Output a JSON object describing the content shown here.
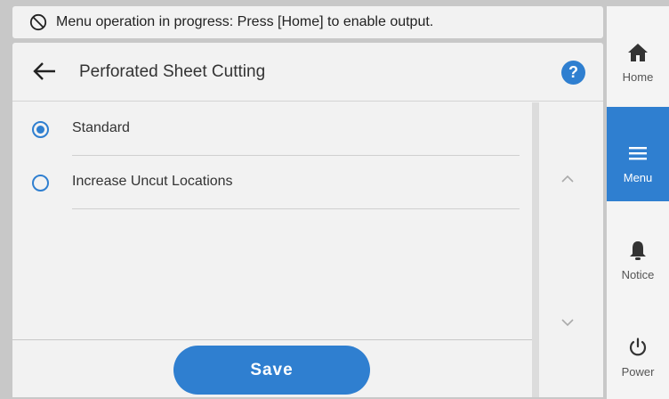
{
  "banner": {
    "text": "Menu operation in progress: Press [Home] to enable output.",
    "icon": "no-entry-icon"
  },
  "header": {
    "title": "Perforated Sheet Cutting",
    "back_icon": "back-arrow-icon",
    "help_label": "?"
  },
  "options": [
    {
      "label": "Standard",
      "selected": true
    },
    {
      "label": "Increase Uncut Locations",
      "selected": false
    }
  ],
  "footer": {
    "save_label": "Save"
  },
  "nav": {
    "items": [
      {
        "label": "Home",
        "icon": "home-icon",
        "active": false
      },
      {
        "label": "Menu",
        "icon": "menu-icon",
        "active": true
      },
      {
        "label": "Notice",
        "icon": "bell-icon",
        "active": false
      },
      {
        "label": "Power",
        "icon": "power-icon",
        "active": false
      }
    ]
  },
  "colors": {
    "accent": "#2f7fd0",
    "background": "#f2f2f2",
    "frame": "#c8c8c8"
  }
}
